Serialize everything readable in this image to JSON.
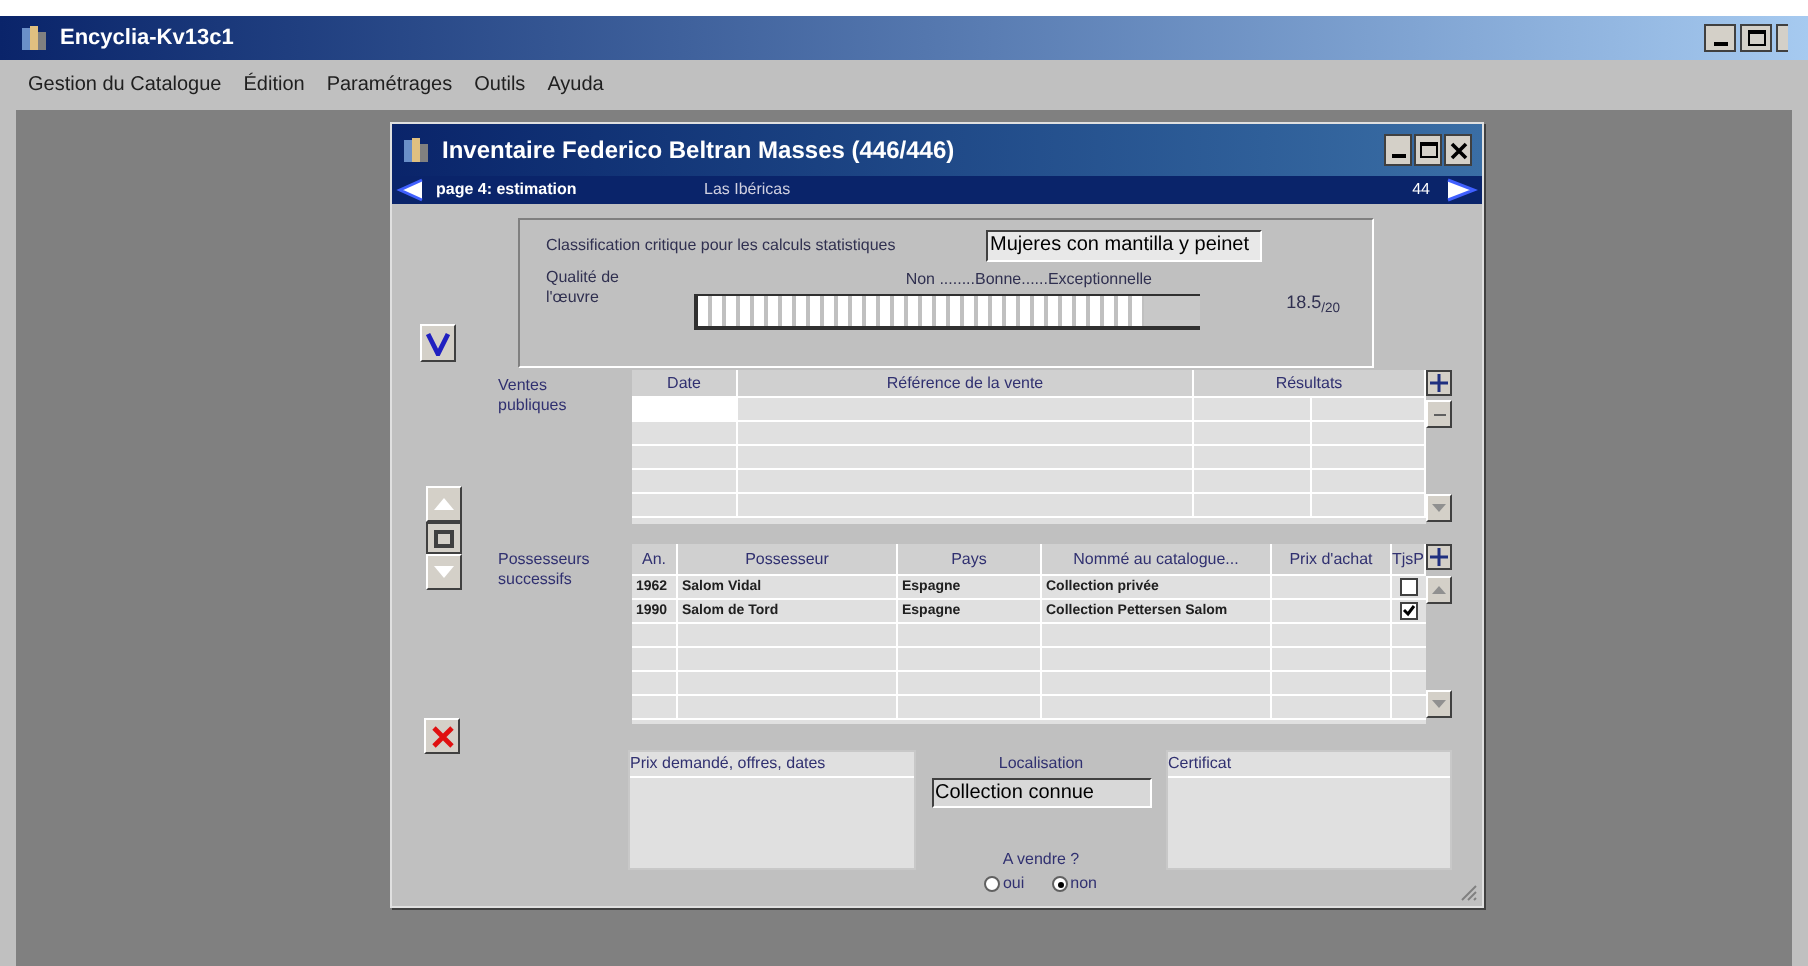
{
  "app": {
    "title": "Encyclia-Kv13c1"
  },
  "menu": [
    "Gestion du Catalogue",
    "Édition",
    "Paramétrages",
    "Outils",
    "Ayuda"
  ],
  "window": {
    "title": "Inventaire Federico Beltran Masses (446/446)"
  },
  "nav": {
    "page": "page 4: estimation",
    "record": "Las Ibéricas",
    "number": "44"
  },
  "classification": {
    "label": "Classification critique pour les calculs statistiques",
    "value": "Mujeres con mantilla y peinet",
    "quality_label": "Qualité de l'œuvre",
    "scale": "Non ........Bonne......Exceptionnelle",
    "level": 0.89,
    "score": "18.5$_{/20}$"
  },
  "sales": {
    "label": "Ventes publiques",
    "columns": [
      "Date",
      "Référence de la vente",
      "Résultats"
    ]
  },
  "owners": {
    "label": "Possesseurs successifs",
    "columns": [
      "An.",
      "Possesseur",
      "Pays",
      "Nommé au catalogue...",
      "Prix d'achat",
      "TjsP"
    ],
    "rows": [
      {
        "year": "1962",
        "owner": "Salom Vidal",
        "country": "Espagne",
        "catalogue": "Collection privée",
        "checked": false
      },
      {
        "year": "1990",
        "owner": "Salom de Tord",
        "country": "Espagne",
        "catalogue": "Collection Pettersen Salom",
        "checked": true
      }
    ]
  },
  "bottom": {
    "price_label": "Prix demandé, offres, dates",
    "location_label": "Localisation",
    "location_value": "Collection connue",
    "for_sale_label": "A vendre ?",
    "options": [
      {
        "label": "oui",
        "selected": false
      },
      {
        "label": "non",
        "selected": true
      }
    ],
    "certificate_label": "Certificat"
  }
}
